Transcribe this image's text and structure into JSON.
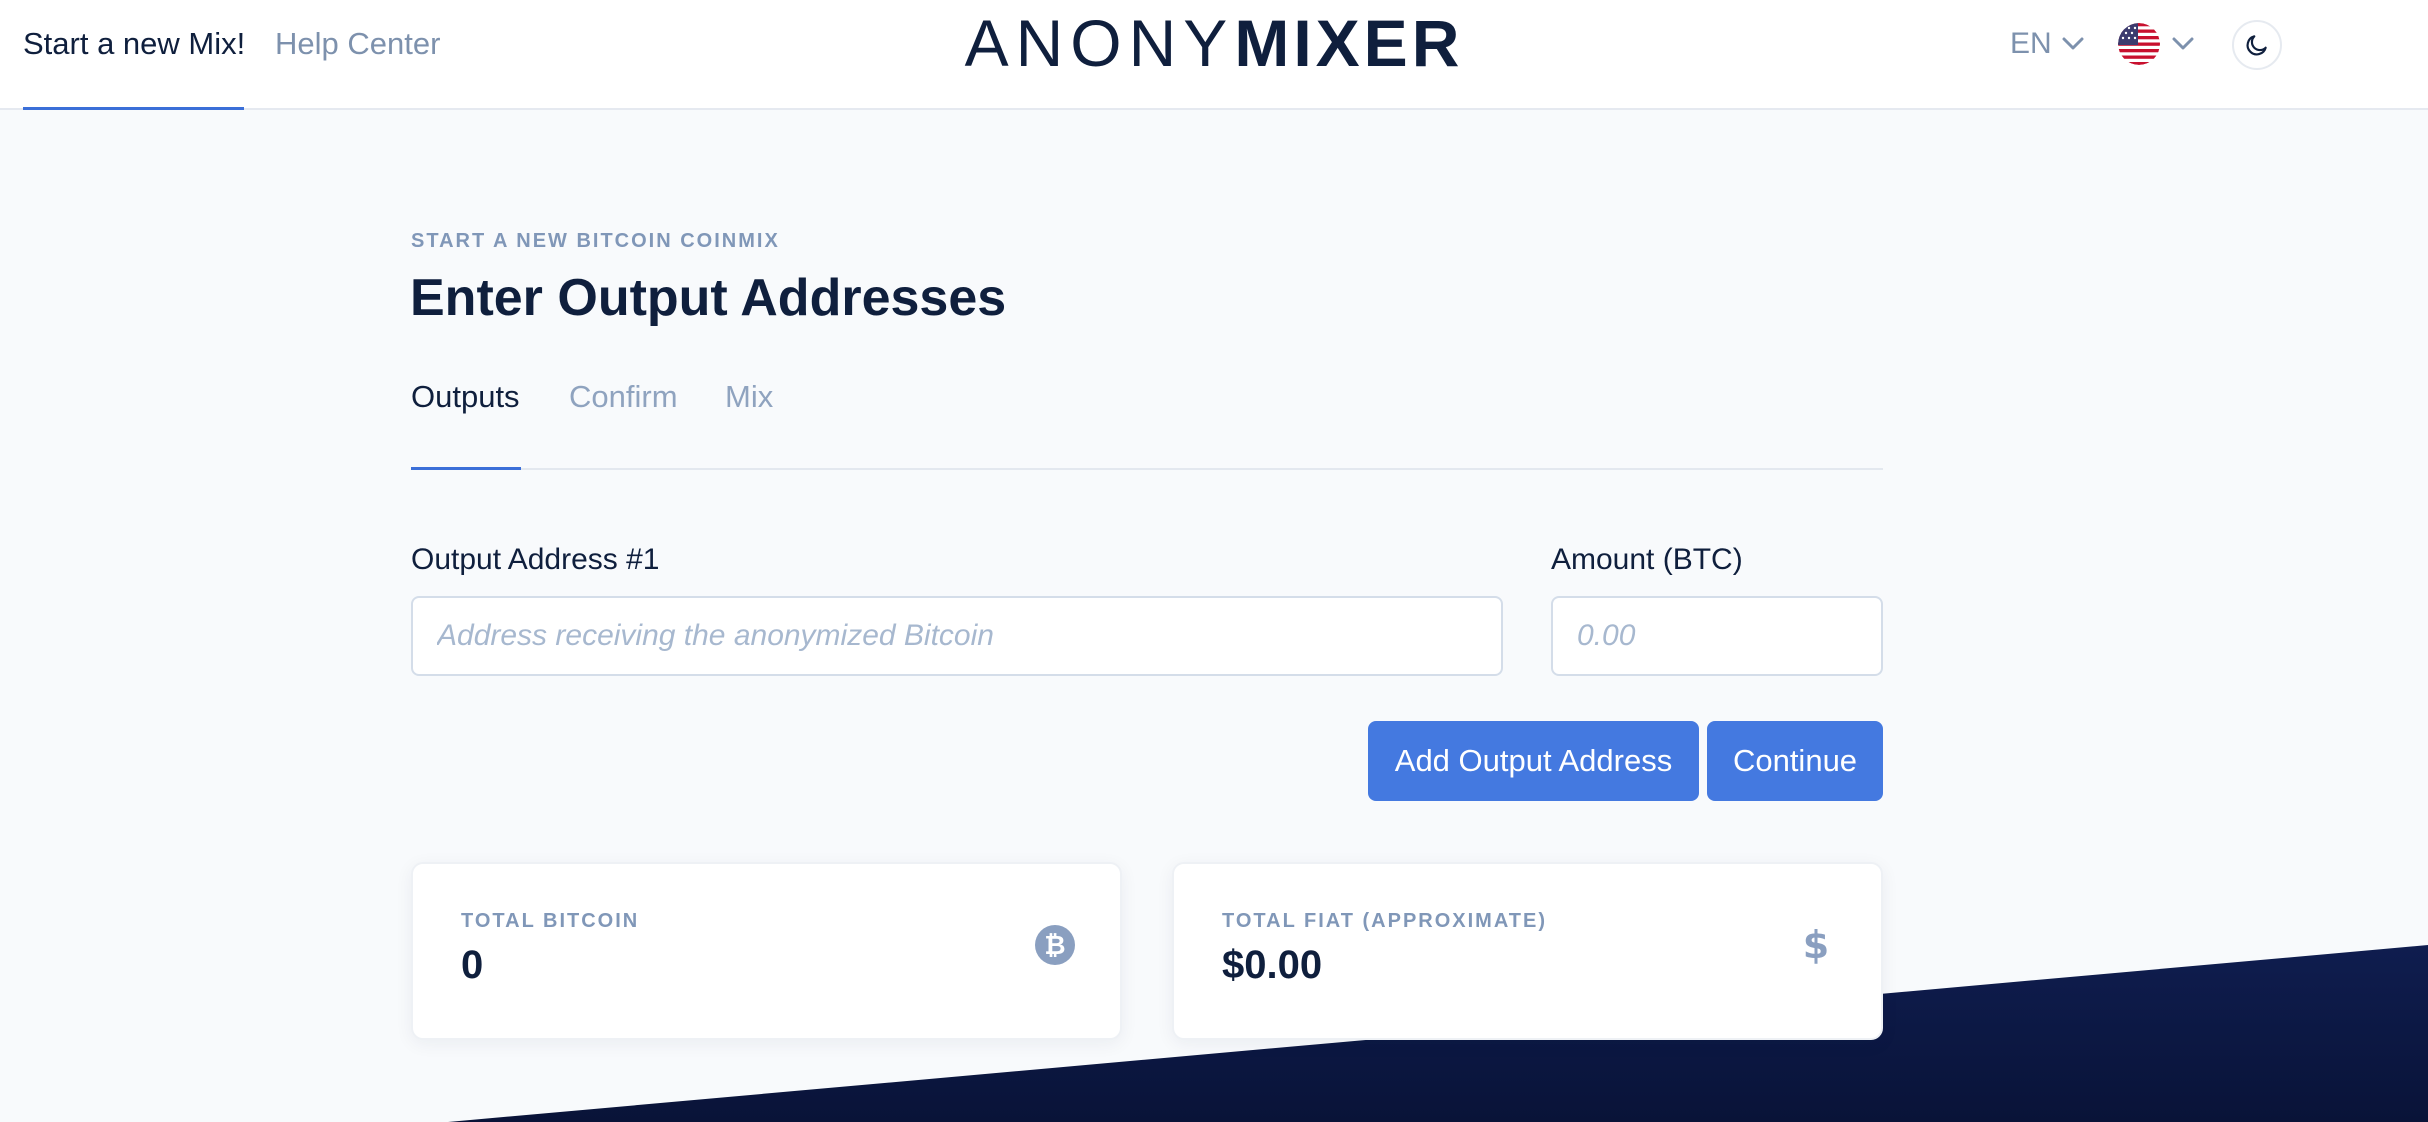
{
  "header": {
    "nav": [
      {
        "label": "Start a new Mix!",
        "active": true
      },
      {
        "label": "Help Center",
        "active": false
      }
    ],
    "logo": {
      "light": "ANONY",
      "bold": "MIXER"
    },
    "language": "EN",
    "currency_flag_icon": "us-flag-icon",
    "theme_toggle_icon": "moon-icon"
  },
  "main": {
    "eyebrow": "START A NEW BITCOIN COINMIX",
    "title": "Enter Output Addresses",
    "tabs": [
      {
        "label": "Outputs",
        "active": true
      },
      {
        "label": "Confirm",
        "active": false
      },
      {
        "label": "Mix",
        "active": false
      }
    ],
    "address_field": {
      "label": "Output Address #1",
      "placeholder": "Address receiving the anonymized Bitcoin",
      "value": ""
    },
    "amount_field": {
      "label": "Amount (BTC)",
      "placeholder": "0.00",
      "value": ""
    },
    "add_button_label": "Add Output Address",
    "continue_button_label": "Continue"
  },
  "totals": {
    "bitcoin": {
      "label": "TOTAL BITCOIN",
      "value": "0",
      "icon": "bitcoin-icon"
    },
    "fiat": {
      "label": "TOTAL FIAT (APPROXIMATE)",
      "value": "$0.00",
      "icon": "dollar-icon"
    }
  },
  "colors": {
    "accent": "#4479e0",
    "text_dark": "#0f1f3d",
    "text_muted": "#8097b8",
    "footer_navy": "#0d1a45"
  }
}
